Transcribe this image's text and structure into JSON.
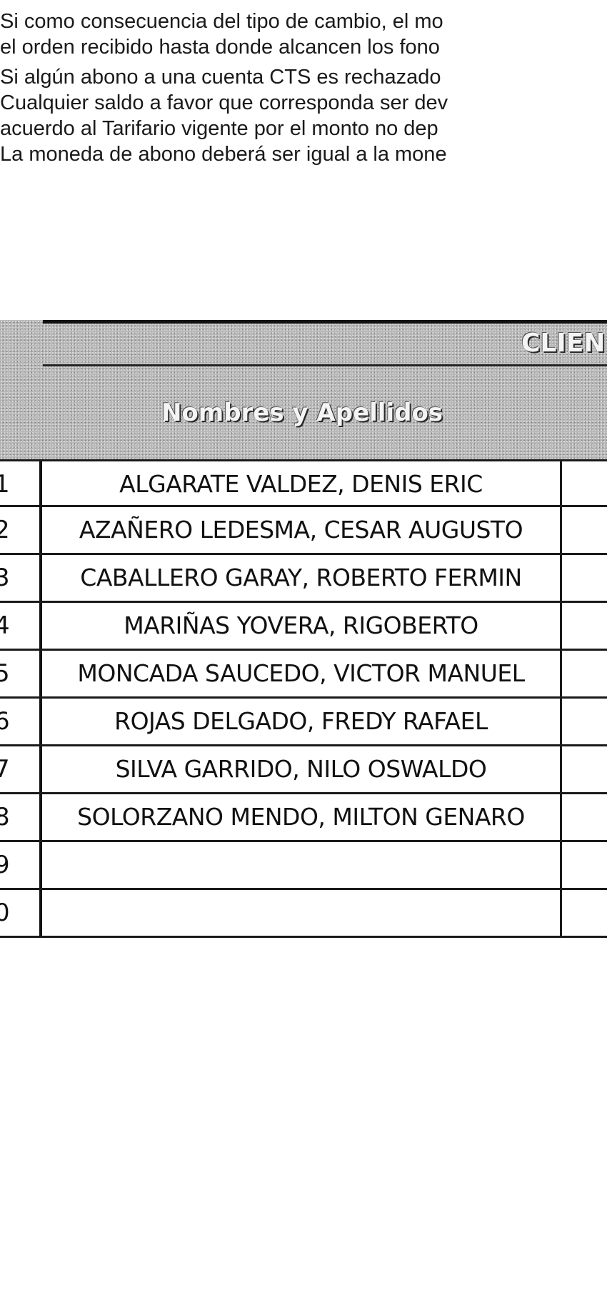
{
  "notes": [
    "Si como consecuencia del tipo de cambio, el mo",
    " el orden recibido hasta donde alcancen los fono",
    "Si algún abono a una cuenta CTS es rechazado",
    "Cualquier saldo a favor que corresponda ser dev",
    " acuerdo al Tarifario vigente por el monto no dep",
    "La moneda de abono deberá ser igual a la mone"
  ],
  "table": {
    "section_header": "CLIEN",
    "column_header": "Nombres y Apellidos",
    "rows": [
      {
        "num": "1",
        "name": "ALGARATE VALDEZ, DENIS ERIC"
      },
      {
        "num": "2",
        "name": "AZAÑERO LEDESMA, CESAR AUGUSTO"
      },
      {
        "num": "3",
        "name": "CABALLERO GARAY, ROBERTO FERMIN"
      },
      {
        "num": "4",
        "name": "MARIÑAS YOVERA, RIGOBERTO"
      },
      {
        "num": "5",
        "name": "MONCADA SAUCEDO, VICTOR MANUEL"
      },
      {
        "num": "6",
        "name": "ROJAS DELGADO, FREDY RAFAEL"
      },
      {
        "num": "7",
        "name": "SILVA GARRIDO, NILO OSWALDO"
      },
      {
        "num": "8",
        "name": "SOLORZANO MENDO, MILTON GENARO"
      },
      {
        "num": "9",
        "name": ""
      },
      {
        "num": "0",
        "name": ""
      }
    ]
  }
}
